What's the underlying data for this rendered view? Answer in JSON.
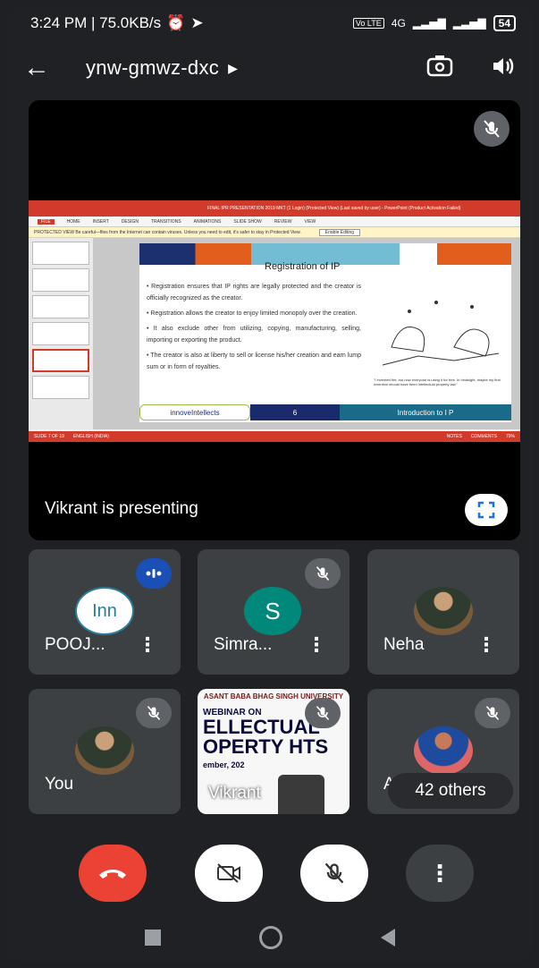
{
  "status_bar": {
    "time_speed": "3:24 PM | 75.0KB/s",
    "network": "4G",
    "battery": "54"
  },
  "header": {
    "meeting_code": "ynw-gmwz-dxc"
  },
  "presentation": {
    "presenter_text": "Vikrant is presenting",
    "ppt_title": "FINAL IPR PRESENTATION 2019 MKT (1 Login) (Protected View) (Last saved by user) - PowerPoint (Product Activation Failed)",
    "ribbon_tabs": [
      "FILE",
      "HOME",
      "INSERT",
      "DESIGN",
      "TRANSITIONS",
      "ANIMATIONS",
      "SLIDE SHOW",
      "REVIEW",
      "VIEW"
    ],
    "protected_msg": "PROTECTED VIEW  Be careful—files from the Internet can contain viruses. Unless you need to edit, it's safer to stay in Protected View.",
    "enable_editing": "Enable Editing",
    "slide_heading": "Registration of IP",
    "bullets": [
      "Registration ensures that IP rights are legally protected and the creator is officially recognized as the creator.",
      "Registration allows the creator to enjoy limited monopoly over the creation.",
      "It also exclude other from utilizing, copying, manufacturing, selling, importing or exporting the product.",
      "The creator is also at liberty to sell or license his/her creation and earn lump sum or in form of royalties."
    ],
    "cartoon_caption": "\"I invented fire, but now everyone is using it for free. In hindsight, maybe my first invention should have been intellectual property law.\"",
    "footer_logo": "innoveIntellects",
    "footer_num": "6",
    "footer_intro": "Introduction to I P",
    "status_slide": "SLIDE 7 OF 19",
    "status_lang": "ENGLISH (INDIA)",
    "status_notes": "NOTES",
    "status_comments": "COMMENTS",
    "status_zoom": "79%"
  },
  "participants": [
    {
      "name": "POOJ...",
      "avatar_text": "Inn"
    },
    {
      "name": "Simra...",
      "avatar_text": "S"
    },
    {
      "name": "Neha"
    },
    {
      "name": "You"
    },
    {
      "name": "Vikrant",
      "webinar": {
        "t1": "ASANT BABA BHAG SINGH UNIVERSITY",
        "t2": "WEBINAR ON",
        "t3": "ELLECTUAL OPERTY HTS",
        "t4": "ember, 202"
      }
    },
    {
      "name": "Ad"
    }
  ],
  "others_count": "42 others",
  "colors": {
    "background": "#202124",
    "tile": "#3c4043",
    "end_call": "#ea4335",
    "speaking": "#1a4fb6"
  }
}
